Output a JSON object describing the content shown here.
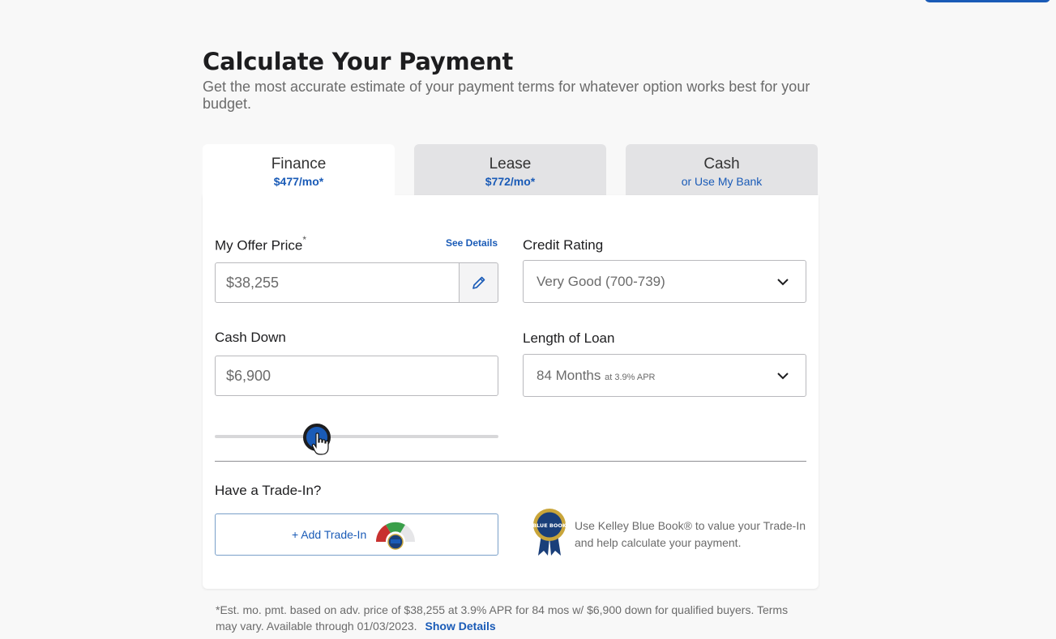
{
  "header": {
    "title": "Calculate Your Payment",
    "subtitle": "Get the most accurate estimate of your payment terms for whatever option works best for your budget."
  },
  "tabs": [
    {
      "label": "Finance",
      "sub": "$477/mo*"
    },
    {
      "label": "Lease",
      "sub": "$772/mo*"
    },
    {
      "label": "Cash",
      "sub": "or Use My Bank"
    }
  ],
  "form": {
    "offer_label": "My Offer Price",
    "offer_asterisk": "*",
    "see_details": "See Details",
    "offer_value": "$38,255",
    "credit_label": "Credit Rating",
    "credit_value": "Very Good (700-739)",
    "cash_down_label": "Cash Down",
    "cash_down_value": "$6,900",
    "loan_label": "Length of Loan",
    "loan_value": "84 Months",
    "loan_apr": "at 3.9% APR",
    "slider_fraction": 0.36
  },
  "trade_in": {
    "heading": "Have a Trade-In?",
    "button_label": "+ Add Trade-In",
    "kbb_text": "Use Kelley Blue Book® to value your Trade-In and help calculate your payment.",
    "badge_text": "BLUE BOOK"
  },
  "disclaimer": {
    "text": "*Est. mo. pmt. based on adv. price of $38,255 at 3.9% APR for 84 mos w/ $6,900 down for qualified buyers. Terms may vary. Available through 01/03/2023.",
    "link": "Show Details"
  },
  "colors": {
    "accent": "#1a5bb7",
    "background": "#f8f8f8",
    "tab_inactive": "#e3e3e5"
  },
  "icons": [
    "pencil-icon",
    "chevron-down-icon",
    "hand-cursor-icon",
    "kbb-gauge-icon",
    "kbb-badge-icon"
  ]
}
